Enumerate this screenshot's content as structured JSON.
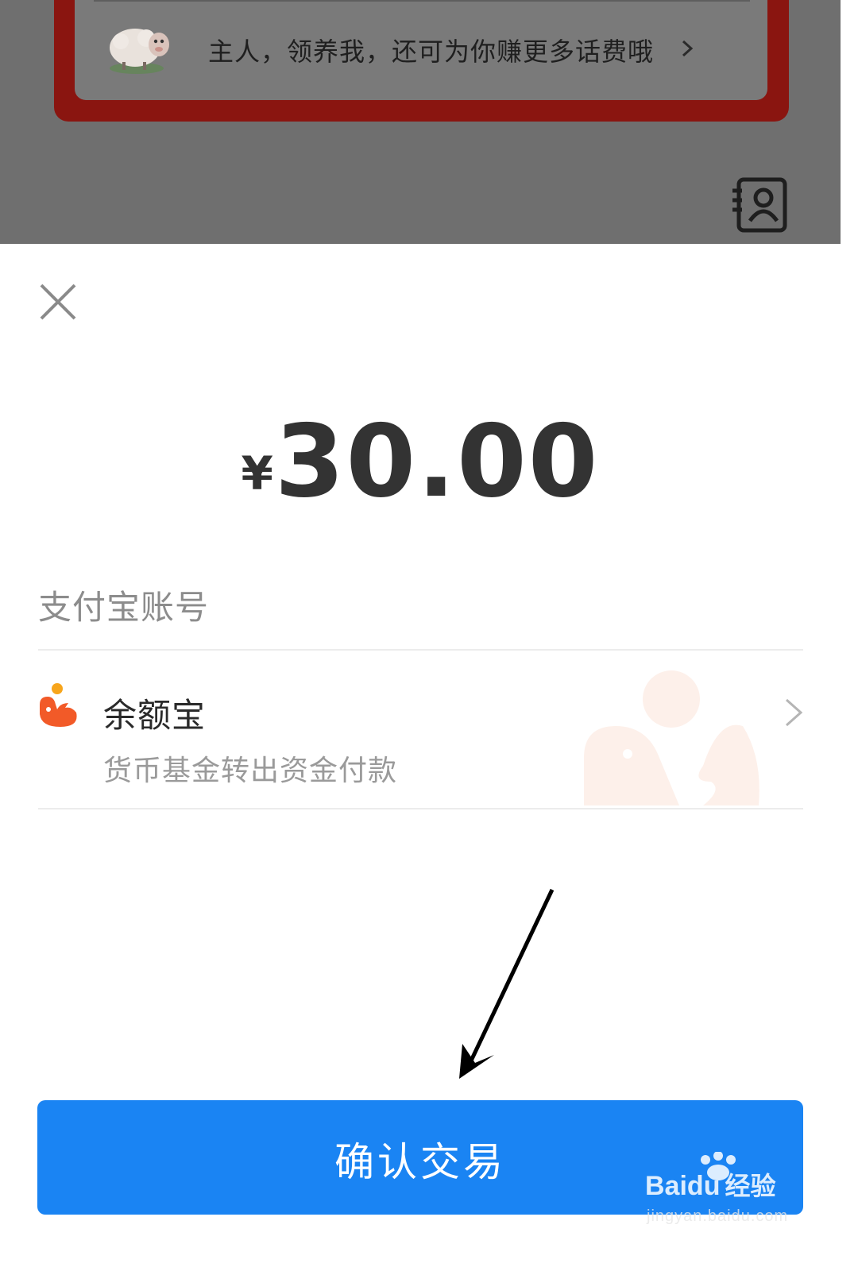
{
  "background_page": {
    "promo_text": "主人，领养我，还可为你赚更多话费哦",
    "promo_chevron": "›",
    "mascot_icon": "sheep-icon",
    "contacts_icon": "contacts-book-icon"
  },
  "payment_sheet": {
    "close_icon": "close-icon",
    "currency_symbol": "¥",
    "amount": "30.00",
    "account_label": "支付宝账号",
    "payment_method": {
      "icon": "yuebao-icon",
      "name": "余额宝",
      "description": "货币基金转出资金付款",
      "chevron_icon": "chevron-right-icon"
    },
    "confirm_button_label": "确认交易"
  },
  "watermark": {
    "brand": "Bai",
    "brand_suffix": "du",
    "cn_label": "经验",
    "url": "jingyan.baidu.com"
  },
  "colors": {
    "primary_button": "#1a84f3",
    "overlay": "#6f6f6f",
    "promo_frame": "#8a1510",
    "yuebao_orange": "#f25a28"
  }
}
